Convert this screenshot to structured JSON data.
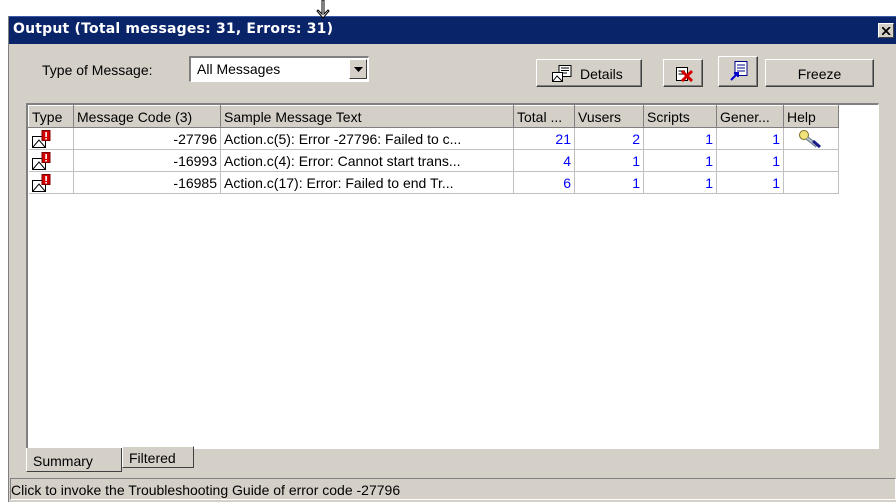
{
  "window": {
    "title": "Output (Total messages: 31, Errors: 31)"
  },
  "toolbar": {
    "type_label": "Type of Message:",
    "type_value": "All Messages",
    "details_label": "Details",
    "freeze_label": "Freeze",
    "icons": {
      "details": "details-icon",
      "clear": "remove-errors-icon",
      "export": "export-icon"
    }
  },
  "grid": {
    "columns": [
      "Type",
      "Message Code (3)",
      "Sample Message Text",
      "Total ...",
      "Vusers",
      "Scripts",
      "Gener...",
      "Help"
    ],
    "rows": [
      {
        "type_icon": "error-message-icon",
        "code": "-27796",
        "text": "Action.c(5): Error -27796: Failed to c...",
        "total": "21",
        "vusers": "2",
        "scripts": "1",
        "generators": "1",
        "help_icon": "troubleshoot-icon"
      },
      {
        "type_icon": "error-message-icon",
        "code": "-16993",
        "text": "Action.c(4): Error: Cannot start trans...",
        "total": "4",
        "vusers": "1",
        "scripts": "1",
        "generators": "1",
        "help_icon": ""
      },
      {
        "type_icon": "error-message-icon",
        "code": "-16985",
        "text": "Action.c(17): Error: Failed to end Tr...",
        "total": "6",
        "vusers": "1",
        "scripts": "1",
        "generators": "1",
        "help_icon": ""
      }
    ]
  },
  "tabs": [
    {
      "label": "Summary",
      "active": true
    },
    {
      "label": "Filtered",
      "active": false
    }
  ],
  "status": {
    "text": "Click to invoke the Troubleshooting Guide of error code -27796"
  },
  "colors": {
    "titlebar": "#0a246a",
    "link": "#0000ff",
    "error": "#d40000"
  }
}
